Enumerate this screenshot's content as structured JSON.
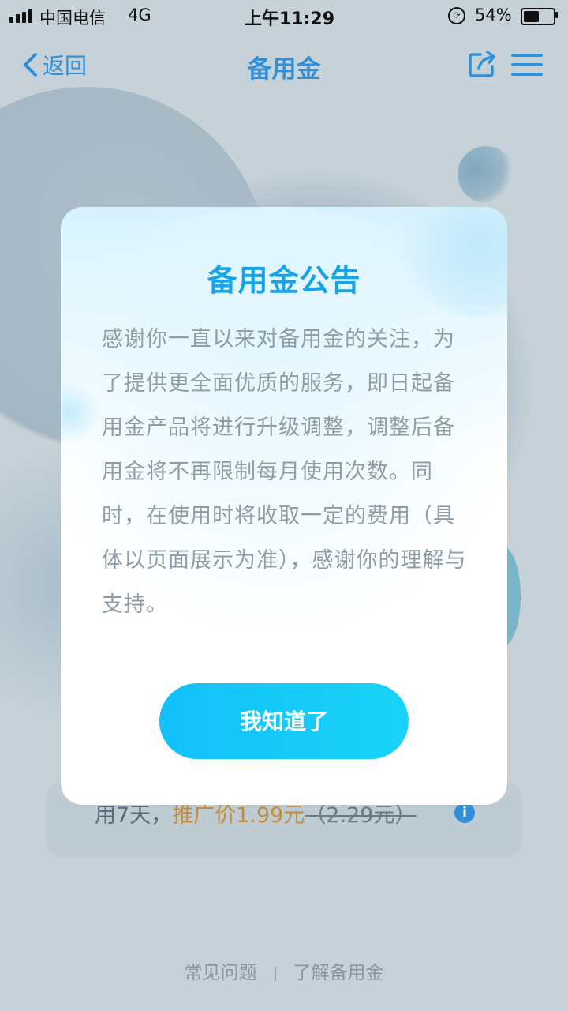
{
  "status_bar": {
    "carrier": "中国电信",
    "network": "4G",
    "time": "上午11:29",
    "battery_percent": "54%",
    "battery_level": 0.54
  },
  "nav": {
    "back_label": "返回",
    "title": "备用金",
    "accent_color": "#2f8fd9"
  },
  "background": {
    "promo_prefix": "用7天，",
    "promo_price": "推广价1.99元",
    "promo_original": "（2.29元）",
    "footer_faq": "常见问题",
    "footer_about": "了解备用金"
  },
  "modal": {
    "title": "备用金公告",
    "body": "感谢你一直以来对备用金的关注，为了提供更全面优质的服务，即日起备用金产品将进行升级调整，调整后备用金将不再限制每月使用次数。同时，在使用时将收取一定的费用（具体以页面展示为准），感谢你的理解与支持。",
    "button_label": "我知道了",
    "button_color": "#12c0fa",
    "title_color": "#15a4ea"
  }
}
